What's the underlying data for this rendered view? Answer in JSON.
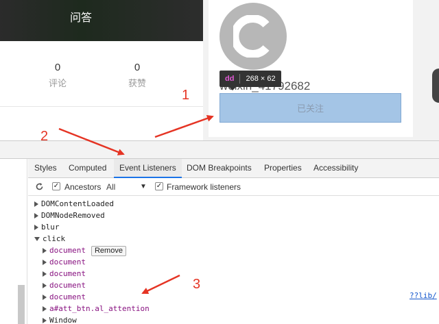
{
  "banner": {
    "title": "问答"
  },
  "stats": [
    {
      "value": "0",
      "label": "评论"
    },
    {
      "value": "0",
      "label": "获赞"
    }
  ],
  "profile": {
    "username": "weixin_41792682",
    "follow_label": "已关注"
  },
  "inspect_tooltip": {
    "tag": "dd",
    "size": "268 × 62"
  },
  "devtools": {
    "tabs": [
      "Styles",
      "Computed",
      "Event Listeners",
      "DOM Breakpoints",
      "Properties",
      "Accessibility"
    ],
    "active_tab": "Event Listeners",
    "filter": {
      "ancestors_label": "Ancestors",
      "ancestors_checked": true,
      "scope": "All",
      "framework_label": "Framework listeners",
      "framework_checked": true
    },
    "events": [
      {
        "name": "DOMContentLoaded",
        "expanded": false
      },
      {
        "name": "DOMNodeRemoved",
        "expanded": false
      },
      {
        "name": "blur",
        "expanded": false
      },
      {
        "name": "click",
        "expanded": true
      }
    ],
    "click_listeners": [
      {
        "target": "document",
        "remove": "Remove"
      },
      {
        "target": "document"
      },
      {
        "target": "document"
      },
      {
        "target": "document"
      },
      {
        "target": "document",
        "source": "??lib/"
      },
      {
        "target": "a#att_btn.al_attention"
      },
      {
        "target": "Window"
      }
    ]
  },
  "annotations": [
    "1",
    "2",
    "3"
  ],
  "colors": {
    "annotation": "#e53424",
    "follow_bg": "#a4c5e6",
    "active_tab": "#1a73e8"
  }
}
